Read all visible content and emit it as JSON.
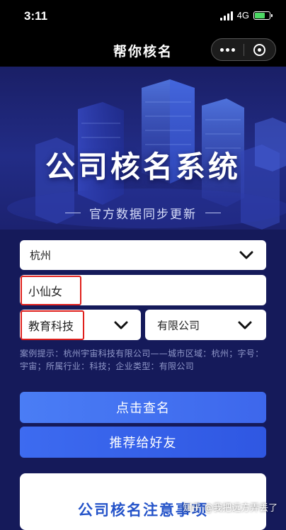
{
  "status": {
    "time": "3:11",
    "network": "4G",
    "battery_level": 0.75
  },
  "nav": {
    "title": "帮你核名",
    "more_icon": "more-dots-icon",
    "close_icon": "close-circle-icon"
  },
  "hero": {
    "title": "公司核名系统",
    "subtitle": "官方数据同步更新"
  },
  "form": {
    "city": {
      "value": "杭州"
    },
    "name": {
      "value": "小仙女"
    },
    "industry": {
      "value": "教育科技"
    },
    "company_type": {
      "value": "有限公司"
    }
  },
  "hint": "案例提示：杭州宇宙科技有限公司——城市区域：杭州；字号：宇宙；所属行业：科技；企业类型：有限公司",
  "buttons": {
    "query": "点击查名",
    "share": "推荐给好友"
  },
  "notice": {
    "title": "公司核名注意事项"
  },
  "watermark": "知乎 @我把远方弄丢了",
  "colors": {
    "background": "#151a5a",
    "button": "#3d67ec",
    "highlight": "#e0201c",
    "notice_title": "#2453c9"
  }
}
